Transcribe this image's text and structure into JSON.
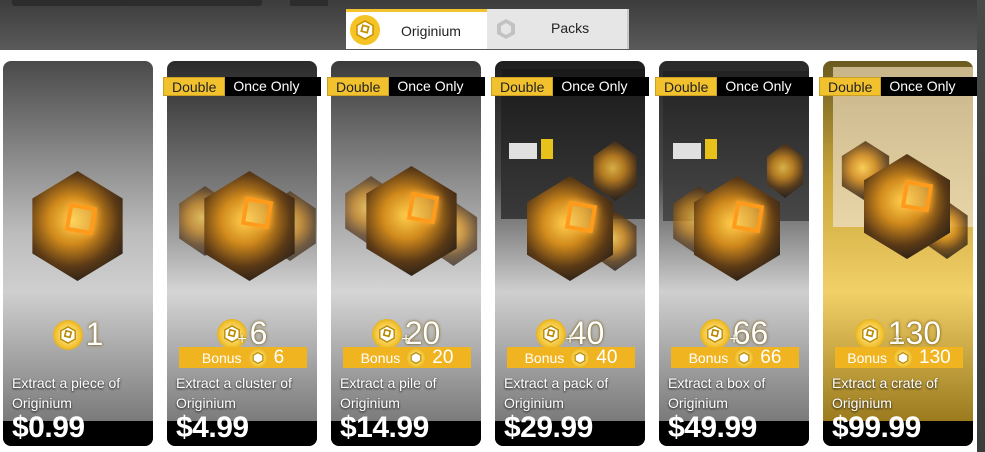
{
  "tabs": [
    {
      "label": "Originium",
      "icon": "originium-icon",
      "active": true
    },
    {
      "label": "Packs",
      "icon": "packs-icon",
      "active": false
    }
  ],
  "badge": {
    "double": "Double",
    "once": "Once Only"
  },
  "bonus_label": "Bonus",
  "plus": "+",
  "cards": [
    {
      "amount": "1",
      "bonus": "",
      "desc": "Extract a piece of Originium",
      "price": "$0.99",
      "has_badge": false
    },
    {
      "amount": "6",
      "bonus": "6",
      "desc": "Extract a cluster of Originium",
      "price": "$4.99",
      "has_badge": true
    },
    {
      "amount": "20",
      "bonus": "20",
      "desc": "Extract a pile of Originium",
      "price": "$14.99",
      "has_badge": true
    },
    {
      "amount": "40",
      "bonus": "40",
      "desc": "Extract a pack of Originium",
      "price": "$29.99",
      "has_badge": true
    },
    {
      "amount": "66",
      "bonus": "66",
      "desc": "Extract a box of Originium",
      "price": "$49.99",
      "has_badge": true
    },
    {
      "amount": "130",
      "bonus": "130",
      "desc": "Extract a crate of Originium",
      "price": "$99.99",
      "has_badge": true
    }
  ],
  "colors": {
    "accent": "#f2c12e",
    "price_band": "#000000"
  }
}
